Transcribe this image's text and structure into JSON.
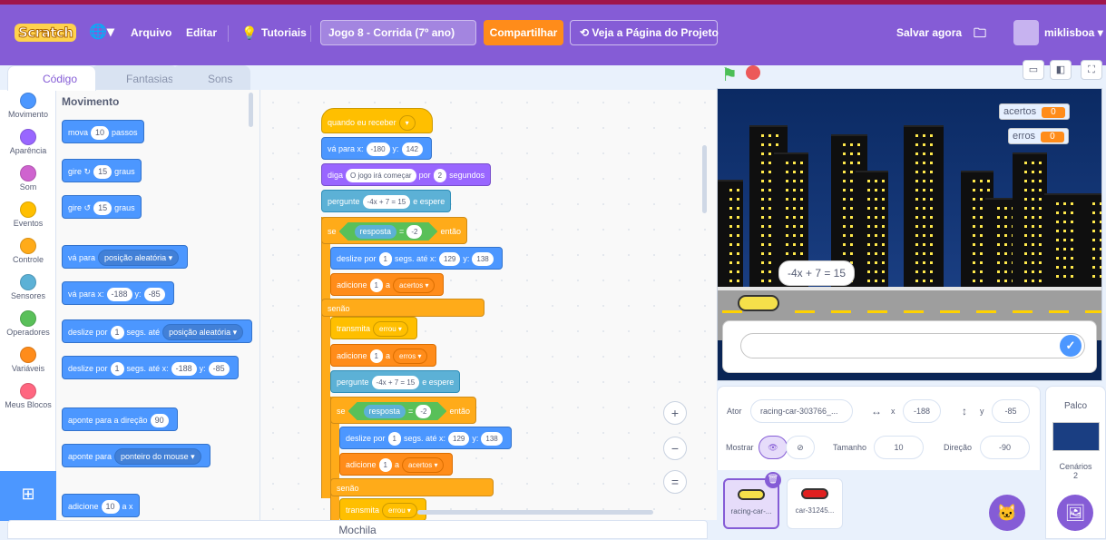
{
  "menu": {
    "logo": "Scratch",
    "language_icon": "globe-icon",
    "file": "Arquivo",
    "edit": "Editar",
    "tutorials": "Tutoriais",
    "project_title": "Jogo 8 - Corrida (7º ano)",
    "share": "Compartilhar",
    "see_project": "Veja a Página do Projeto",
    "save_now": "Salvar agora",
    "username": "miklisboa"
  },
  "tabs": {
    "code": "Código",
    "costumes": "Fantasias",
    "sounds": "Sons"
  },
  "categories": [
    {
      "label": "Movimento",
      "color": "#4c97ff"
    },
    {
      "label": "Aparência",
      "color": "#9966ff"
    },
    {
      "label": "Som",
      "color": "#cf63cf"
    },
    {
      "label": "Eventos",
      "color": "#ffbf00"
    },
    {
      "label": "Controle",
      "color": "#ffab19"
    },
    {
      "label": "Sensores",
      "color": "#5cb1d6"
    },
    {
      "label": "Operadores",
      "color": "#59c059"
    },
    {
      "label": "Variáveis",
      "color": "#ff8c1a"
    },
    {
      "label": "Meus Blocos",
      "color": "#ff6680"
    }
  ],
  "palette": {
    "title": "Movimento",
    "move": {
      "pre": "mova",
      "val": "10",
      "post": "passos"
    },
    "turn_right": {
      "pre": "gire",
      "val": "15",
      "post": "graus"
    },
    "turn_left": {
      "pre": "gire",
      "val": "15",
      "post": "graus"
    },
    "goto": {
      "pre": "vá para",
      "drop": "posição aleatória"
    },
    "gotoxy": {
      "pre": "vá para x:",
      "x": "-188",
      "ylbl": "y:",
      "y": "-85"
    },
    "glide_rand": {
      "pre": "deslize por",
      "val": "1",
      "mid": "segs. até",
      "drop": "posição aleatória"
    },
    "glide_xy": {
      "pre": "deslize por",
      "val": "1",
      "mid": "segs. até x:",
      "x": "-188",
      "ylbl": "y:",
      "y": "-85"
    },
    "point_dir": {
      "pre": "aponte para a direção",
      "val": "90"
    },
    "point_to": {
      "pre": "aponte para",
      "drop": "ponteiro do mouse"
    },
    "change_x": {
      "pre": "adicione",
      "val": "10",
      "post": "a x"
    }
  },
  "script": {
    "hat": {
      "pre": "quando eu receber"
    },
    "goto": {
      "pre": "vá para x:",
      "x": "-180",
      "ylbl": "y:",
      "y": "142"
    },
    "say": {
      "pre": "diga",
      "text": "O jogo irá começar",
      "mid": "por",
      "val": "2",
      "post": "segundos"
    },
    "ask1": {
      "pre": "pergunte",
      "text": "-4x + 7 = 15",
      "post": "e espere"
    },
    "if1": {
      "pre": "se",
      "sub": "resposta",
      "op": "=",
      "val": "-2",
      "post": "então"
    },
    "glide1": {
      "pre": "deslize por",
      "val": "1",
      "mid": "segs. até x:",
      "x": "129",
      "ylbl": "y:",
      "y": "138"
    },
    "add1": {
      "pre": "adicione",
      "val": "1",
      "mid": "a",
      "drop": "acertos"
    },
    "else1": "senão",
    "broadcast1": {
      "pre": "transmita",
      "drop": "errou"
    },
    "add2": {
      "pre": "adicione",
      "val": "1",
      "mid": "a",
      "drop": "erros"
    },
    "ask2": {
      "pre": "pergunte",
      "text": "-4x + 7 = 15",
      "post": "e espere"
    },
    "if2": {
      "pre": "se",
      "sub": "resposta",
      "op": "=",
      "val": "-2",
      "post": "então"
    },
    "glide2": {
      "pre": "deslize por",
      "val": "1",
      "mid": "segs. até x:",
      "x": "129",
      "ylbl": "y:",
      "y": "138"
    },
    "add3": {
      "pre": "adicione",
      "val": "1",
      "mid": "a",
      "drop": "acertos"
    },
    "else2": "senão",
    "broadcast2": {
      "pre": "transmita",
      "drop": "errou"
    }
  },
  "backpack": "Mochila",
  "stage": {
    "monitor1": {
      "label": "acertos",
      "value": "0"
    },
    "monitor2": {
      "label": "erros",
      "value": "0"
    },
    "bubble": "-4x + 7 = 15"
  },
  "sprite_info": {
    "actor_label": "Ator",
    "actor_name": "racing-car-303766_...",
    "x_label": "x",
    "x": "-188",
    "y_label": "y",
    "y": "-85",
    "show_label": "Mostrar",
    "size_label": "Tamanho",
    "size": "10",
    "direction_label": "Direção",
    "direction": "-90"
  },
  "sprites": [
    {
      "name": "racing-car-...",
      "color": "#f5e04a"
    },
    {
      "name": "car-31245...",
      "color": "#e02020"
    }
  ],
  "stage_pane": {
    "title": "Palco",
    "backdrops_label": "Cenários",
    "backdrops_count": "2"
  }
}
